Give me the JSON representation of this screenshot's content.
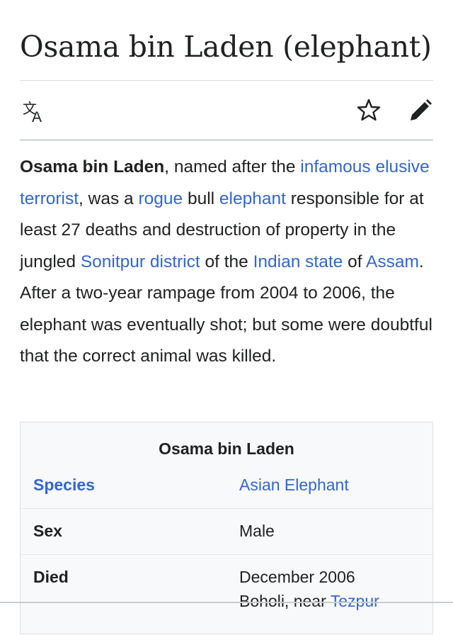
{
  "article": {
    "title": "Osama bin Laden (elephant)"
  },
  "toolbar": {
    "language_icon": "translate-icon",
    "watch_icon": "star-outline-icon",
    "edit_icon": "pencil-icon"
  },
  "lead": {
    "subject": "Osama bin Laden",
    "t1": ", named after the ",
    "link_infamous": "infamous",
    "t2": " ",
    "link_terrorist": "elusive terrorist",
    "t3": ", was a ",
    "link_rogue": "rogue",
    "t4": " bull ",
    "link_elephant": "elephant",
    "t5": " responsible for at least 27 deaths and destruction of property in the jungled ",
    "link_sonitpur": "Sonitpur district",
    "t6": " of the ",
    "link_indian_state": "Indian state",
    "t7": " of ",
    "link_assam": "Assam",
    "t8": ". After a two-year rampage from 2004 to 2006, the elephant was eventually shot; but some were doubtful that the correct animal was killed."
  },
  "infobox": {
    "caption": "Osama bin Laden",
    "rows": [
      {
        "label": "Species",
        "value": "Asian Elephant"
      },
      {
        "label": "Sex",
        "value": "Male"
      },
      {
        "label": "Died",
        "value": "December 2006",
        "value_line2_text": "Boholi, near ",
        "value_line2_link": "Tezpur"
      }
    ]
  },
  "colors": {
    "link": "#3366cc",
    "text": "#202122",
    "infobox_bg": "#f8f9fa"
  }
}
